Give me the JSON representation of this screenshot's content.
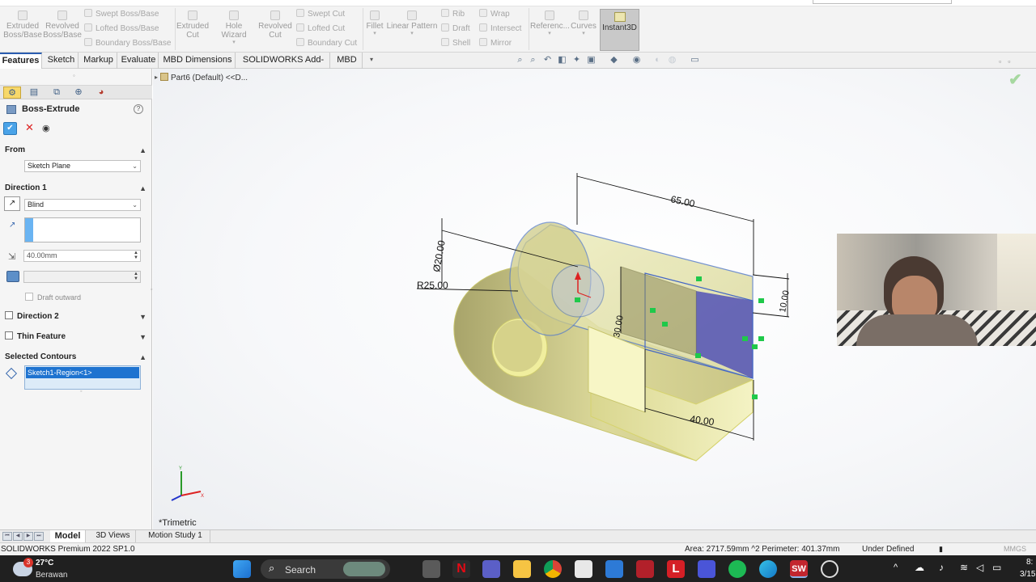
{
  "ribbon": {
    "groups": [
      {
        "buttons": [
          "Extruded Boss/Base",
          "Revolved Boss/Base"
        ]
      },
      {
        "small": [
          "Swept Boss/Base",
          "Lofted Boss/Base",
          "Boundary Boss/Base"
        ]
      },
      {
        "buttons": [
          "Extruded Cut",
          "Hole Wizard",
          "Revolved Cut"
        ]
      },
      {
        "small": [
          "Swept Cut",
          "Lofted Cut",
          "Boundary Cut"
        ]
      },
      {
        "buttons": [
          "Fillet",
          "Linear Pattern"
        ]
      },
      {
        "small": [
          "Rib",
          "Draft",
          "Shell"
        ]
      },
      {
        "small": [
          "Wrap",
          "Intersect",
          "Mirror"
        ]
      },
      {
        "buttons": [
          "Referenc...",
          "Curves",
          "Instant3D"
        ]
      }
    ],
    "extruded_boss_l1": "Extruded",
    "extruded_boss_l2": "Boss/Base",
    "revolved_boss_l1": "Revolved",
    "revolved_boss_l2": "Boss/Base",
    "swept_boss": "Swept Boss/Base",
    "lofted_boss": "Lofted Boss/Base",
    "boundary_boss": "Boundary Boss/Base",
    "extruded_cut_l1": "Extruded",
    "extruded_cut_l2": "Cut",
    "hole_wizard": "Hole Wizard",
    "revolved_cut_l1": "Revolved",
    "revolved_cut_l2": "Cut",
    "swept_cut": "Swept Cut",
    "lofted_cut": "Lofted Cut",
    "boundary_cut": "Boundary Cut",
    "fillet": "Fillet",
    "linear_pattern": "Linear Pattern",
    "rib": "Rib",
    "draft": "Draft",
    "shell": "Shell",
    "wrap": "Wrap",
    "intersect": "Intersect",
    "mirror": "Mirror",
    "reference": "Referenc...",
    "curves": "Curves",
    "instant3d": "Instant3D"
  },
  "tabs": [
    "Features",
    "Sketch",
    "Markup",
    "Evaluate",
    "MBD Dimensions",
    "SOLIDWORKS Add-Ins",
    "MBD"
  ],
  "tab_labels": {
    "features": "Features",
    "sketch": "Sketch",
    "markup": "Markup",
    "evaluate": "Evaluate",
    "mbd_dimensions": "MBD Dimensions",
    "addins": "SOLIDWORKS Add-Ins",
    "mbd": "MBD"
  },
  "property_manager": {
    "title": "Boss-Extrude",
    "help": "?",
    "from_label": "From",
    "from_value": "Sketch Plane",
    "direction1_label": "Direction 1",
    "end_condition": "Blind",
    "depth": "40.00mm",
    "draft_outward": "Draft outward",
    "direction2_label": "Direction 2",
    "thin_feature_label": "Thin Feature",
    "selected_contours_label": "Selected Contours",
    "contour_item": "Sketch1-Region<1>"
  },
  "graphics": {
    "breadcrumb": "Part6 (Default) <<D...",
    "view_name": "*Trimetric",
    "dimensions": {
      "length": "65.00",
      "diameter": "Ø20.00",
      "radius": "R25.00",
      "height": "10.00",
      "slot": "30.00",
      "depth": "40.00"
    },
    "accent_color": "#2a5db0",
    "body_color": "#e4e29a",
    "selected_face_color": "#5a5ab6"
  },
  "bottom_tabs": {
    "model": "Model",
    "views3d": "3D Views",
    "motion": "Motion Study 1"
  },
  "status": {
    "product": "SOLIDWORKS Premium 2022 SP1.0",
    "measure": "Area: 2717.59mm ^2 Perimeter: 401.37mm",
    "state": "Under Defined",
    "units": "MMGS"
  },
  "taskbar": {
    "temperature": "27°C",
    "weather": "Berawan",
    "weather_badge": "3",
    "search": "Search",
    "time": "8:",
    "date": "3/15"
  }
}
